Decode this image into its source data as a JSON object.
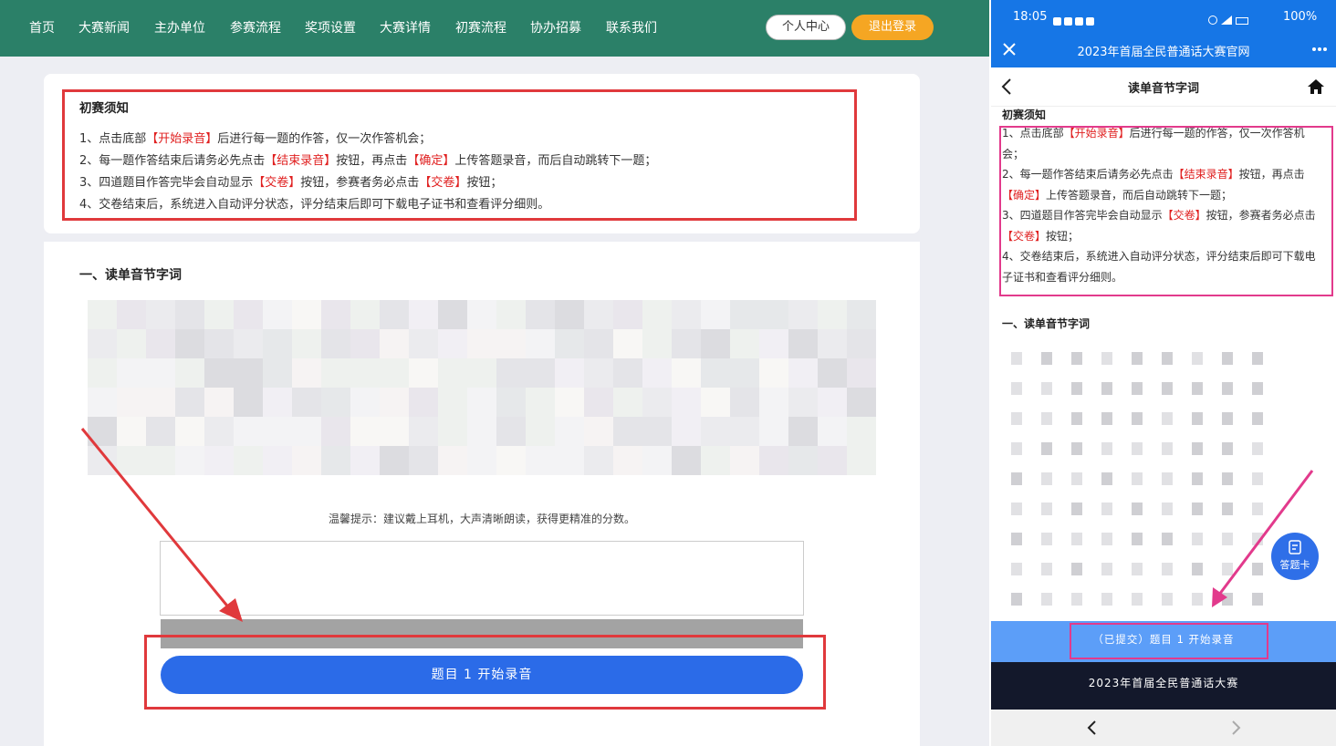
{
  "desktop": {
    "nav": [
      "首页",
      "大赛新闻",
      "主办单位",
      "参赛流程",
      "奖项设置",
      "大赛详情",
      "初赛流程",
      "协办招募",
      "联系我们"
    ],
    "personal_center": "个人中心",
    "logout": "退出登录",
    "notice": {
      "title": "初赛须知",
      "lines": [
        {
          "a": "1、点击底部",
          "h": "【开始录音】",
          "b": "后进行每一题的作答，仅一次作答机会；"
        },
        {
          "a": "2、每一题作答结束后请务必先点击",
          "h": "【结束录音】",
          "b": "按钮，再点击",
          "h2": "【确定】",
          "c": "上传答题录音，而后自动跳转下一题；"
        },
        {
          "a": "3、四道题目作答完毕会自动显示",
          "h": "【交卷】",
          "b": "按钮，参赛者务必点击",
          "h2": "【交卷】",
          "c": "按钮；"
        },
        {
          "a": "4、交卷结束后，系统进入自动评分状态，评分结束后即可下载电子证书和查看评分细则。"
        }
      ]
    },
    "section_title": "一、读单音节字词",
    "tip": "温馨提示：建议戴上耳机，大声清晰朗读，获得更精准的分数。",
    "record_button": "题目 1 开始录音"
  },
  "phone": {
    "time": "18:05",
    "battery": "100%",
    "site_title": "2023年首届全民普通话大赛官网",
    "page_title": "读单音节字词",
    "notice_title": "初赛须知",
    "lines": [
      {
        "a": "1、点击底部",
        "h": "【开始录音】",
        "b": "后进行每一题的作答，仅一次作答机会；"
      },
      {
        "a": "2、每一题作答结束后请务必先点击",
        "h": "【结束录音】",
        "b": "按钮，再点击",
        "h2": "【确定】",
        "c": "上传答题录音，而后自动跳转下一题；"
      },
      {
        "a": "3、四道题目作答完毕会自动显示",
        "h": "【交卷】",
        "b": "按钮，参赛者务必点击",
        "h2": "【交卷】",
        "c": "按钮；"
      },
      {
        "a": "4、交卷结束后，系统进入自动评分状态，评分结束后即可下载电子证书和查看评分细则。"
      }
    ],
    "section_title": "一、读单音节字词",
    "answer_card": "答题卡",
    "submitted_button": "（已提交）题目 1 开始录音",
    "footer": "2023年首届全民普通话大赛"
  },
  "colors": {
    "nav_green": "#2b8068",
    "logout_orange": "#f5a623",
    "record_blue": "#2b6be8",
    "phone_blue": "#1676e6",
    "annotation_red": "#e0393c",
    "annotation_pink": "#e23a8c"
  },
  "icons": [
    "close-icon",
    "more-icon",
    "back-icon",
    "home-icon",
    "answer-card-icon",
    "nav-back-icon",
    "nav-forward-icon"
  ]
}
